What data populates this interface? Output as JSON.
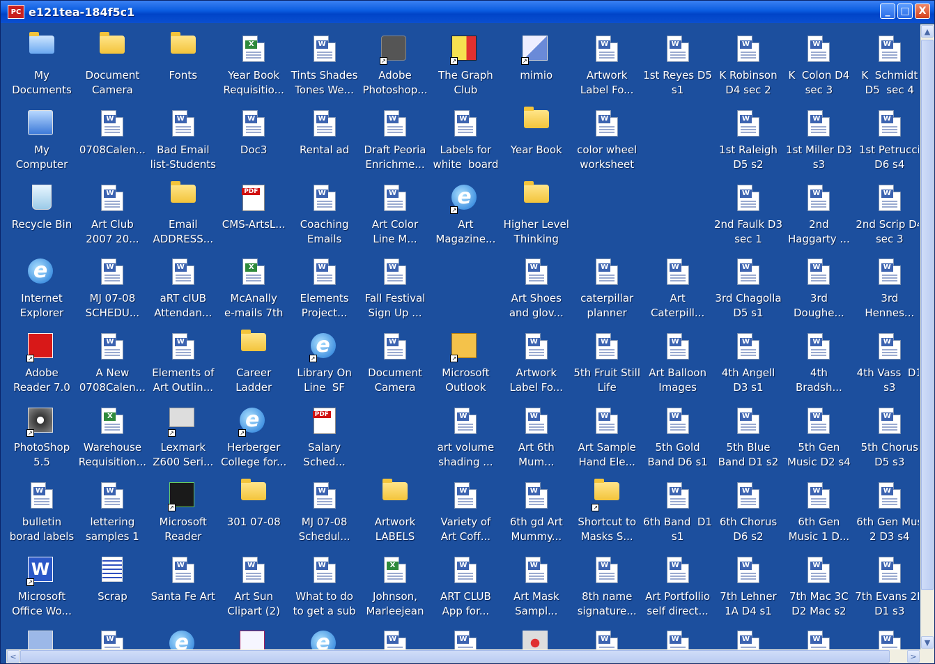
{
  "window": {
    "title": "e121tea-184f5c1",
    "app_icon_text": "PC",
    "buttons": {
      "minimize": "_",
      "maximize": "□",
      "close": "X"
    }
  },
  "scroll": {
    "up": "▲",
    "down": "▼",
    "left": "<",
    "right": ">"
  },
  "icons": [
    [
      "My\nDocuments",
      "Document\nCamera",
      "Fonts",
      "Year Book\nRequisitio...",
      "Tints Shades\nTones We...",
      "Adobe\nPhotoshop...",
      "The Graph\nClub",
      "mimio",
      "Artwork\nLabel Fo...",
      "1st Reyes D5\ns1",
      "K Robinson\nD4 sec 2",
      "K  Colon D4\nsec 3",
      "K  Schmidt\nD5  sec 4"
    ],
    [
      "My\nComputer",
      "0708Calen...",
      "Bad Email\nlist-Students",
      "Doc3",
      "Rental ad",
      "Draft Peoria\nEnrichme...",
      "Labels for\nwhite  board",
      "Year Book",
      "color wheel\nworksheet",
      "",
      "1st Raleigh\nD5 s2",
      "1st Miller D3\ns3",
      "1st Petrucci\nD6 s4"
    ],
    [
      "Recycle Bin",
      "Art Club\n2007 20...",
      "Email\nADDRESS...",
      "CMS-ArtsL...",
      "Coaching\nEmails",
      "Art Color\nLine M...",
      "Art\nMagazine...",
      "Higher Level\nThinking",
      "",
      "",
      "2nd Faulk D3\nsec 1",
      "2nd\nHaggarty ...",
      "2nd Scrip D4\nsec 3"
    ],
    [
      "Internet\nExplorer",
      "MJ 07-08\nSCHEDU...",
      "aRT cIUB\nAttendan...",
      "McAnally\ne-mails 7th",
      "Elements\nProject...",
      "Fall Festival\nSign Up ...",
      "",
      "Art Shoes\nand glov...",
      "caterpillar\nplanner",
      "Art\nCaterpill...",
      "3rd Chagolla\nD5 s1",
      "3rd\nDoughe...",
      "3rd\nHennes..."
    ],
    [
      "Adobe\nReader 7.0",
      "A New\n0708Calen...",
      "Elements of\nArt Outlin...",
      "Career\nLadder",
      "Library On\nLine  SF",
      "Document\nCamera",
      "Microsoft\nOutlook",
      "Artwork\nLabel Fo...",
      "5th Fruit Still\nLife",
      "Art Balloon\nImages",
      "4th Angell\nD3 s1",
      "4th\nBradsh...",
      "4th Vass  D1\ns3"
    ],
    [
      "PhotoShop\n5.5",
      "Warehouse\nRequisition...",
      "Lexmark\nZ600 Seri...",
      "Herberger\nCollege for...",
      "Salary\nSched...",
      "",
      "art volume\nshading ...",
      "Art 6th\nMum...",
      "Art Sample\nHand Ele...",
      "5th Gold\nBand D6 s1",
      "5th Blue\nBand D1 s2",
      "5th Gen\nMusic D2 s4",
      "5th Chorus\nD5 s3"
    ],
    [
      "bulletin\nborad labels",
      "lettering\nsamples 1",
      "Microsoft\nReader",
      "301 07-08",
      "MJ 07-08\nSchedul...",
      "Artwork\nLABELS",
      "Variety of\nArt Coff...",
      "6th gd Art\nMummy...",
      "Shortcut to\nMasks S...",
      "6th Band  D1\ns1",
      "6th Chorus\nD6 s2",
      "6th Gen\nMusic 1 D...",
      "6th Gen Mus\n2 D3 s4"
    ],
    [
      "Microsoft\nOffice Wo...",
      "Scrap",
      "Santa Fe Art",
      "Art Sun\nClipart (2)",
      "What to do\nto get a sub",
      "Johnson,\nMarleejean",
      "ART CLUB\nApp for...",
      "Art Mask\nSampl...",
      "8th name\nsignature...",
      "Art Portfollio\nself direct...",
      "7th Lehner\n1A D4 s1",
      "7th Mac 3C\nD2 Mac s2",
      "7th Evans 2B\nD1 s3"
    ],
    [
      "",
      "",
      "",
      "",
      "",
      "",
      "",
      "",
      "",
      "",
      "",
      "",
      ""
    ]
  ],
  "types": [
    [
      "mydocs",
      "folder",
      "folder",
      "excel",
      "word",
      "camera",
      "graph",
      "mimio",
      "word",
      "word",
      "word",
      "word",
      "word"
    ],
    [
      "computer",
      "word",
      "word",
      "word",
      "word",
      "word",
      "word",
      "folder",
      "word",
      "",
      "word",
      "word",
      "word"
    ],
    [
      "recycle",
      "word",
      "folder",
      "pdf",
      "word",
      "word",
      "ie",
      "folder",
      "",
      "",
      "word",
      "word",
      "word"
    ],
    [
      "ie",
      "word",
      "word",
      "excel",
      "word",
      "word",
      "",
      "word",
      "word",
      "word",
      "word",
      "word",
      "word"
    ],
    [
      "acrobat",
      "word",
      "word",
      "folder",
      "ie",
      "word",
      "outlook",
      "word",
      "word",
      "word",
      "word",
      "word",
      "word"
    ],
    [
      "photoshop",
      "excel",
      "printer",
      "ie",
      "pdf",
      "",
      "word",
      "word",
      "word",
      "word",
      "word",
      "word",
      "word"
    ],
    [
      "word",
      "word",
      "reader",
      "folder",
      "word",
      "folder",
      "word",
      "word",
      "folder",
      "word",
      "word",
      "word",
      "word"
    ],
    [
      "msword",
      "scrap",
      "word",
      "word",
      "word",
      "excel",
      "word",
      "wordmask",
      "word",
      "word",
      "word",
      "word",
      "word"
    ],
    [
      "calc",
      "word",
      "ie",
      "book",
      "ie",
      "word",
      "word",
      "dots",
      "word",
      "word",
      "word",
      "word",
      "word"
    ]
  ],
  "shortcuts": [
    [
      0,
      0,
      0,
      0,
      0,
      1,
      1,
      1,
      0,
      0,
      0,
      0,
      0
    ],
    [
      0,
      0,
      0,
      0,
      0,
      0,
      0,
      0,
      0,
      0,
      0,
      0,
      0
    ],
    [
      0,
      0,
      0,
      0,
      0,
      0,
      1,
      0,
      0,
      0,
      0,
      0,
      0
    ],
    [
      0,
      0,
      0,
      0,
      0,
      0,
      0,
      0,
      0,
      0,
      0,
      0,
      0
    ],
    [
      1,
      0,
      0,
      0,
      1,
      0,
      1,
      0,
      0,
      0,
      0,
      0,
      0
    ],
    [
      1,
      0,
      1,
      1,
      0,
      0,
      0,
      0,
      0,
      0,
      0,
      0,
      0
    ],
    [
      0,
      0,
      1,
      0,
      0,
      0,
      0,
      0,
      1,
      0,
      0,
      0,
      0
    ],
    [
      1,
      0,
      0,
      0,
      0,
      0,
      0,
      0,
      0,
      0,
      0,
      0,
      0
    ],
    [
      0,
      0,
      0,
      0,
      0,
      0,
      0,
      0,
      0,
      0,
      0,
      0,
      0
    ]
  ]
}
